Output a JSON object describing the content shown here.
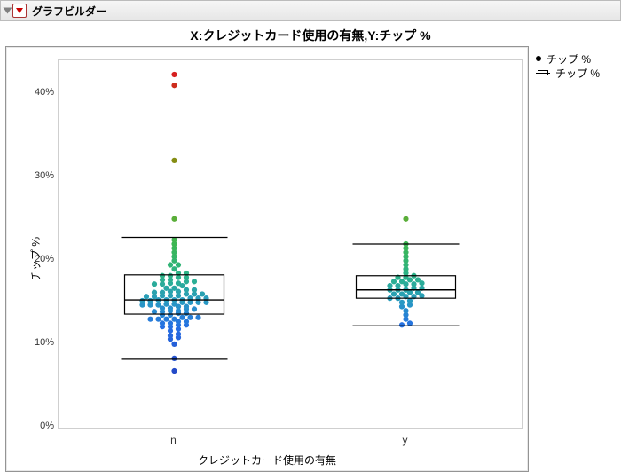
{
  "window": {
    "title": "グラフビルダー"
  },
  "chart_title": "X:クレジットカード使用の有無,Y:チップ %",
  "legend": {
    "points_label": "チップ %",
    "box_label": "チップ %"
  },
  "axes": {
    "ylabel": "チップ %",
    "xlabel": "クレジットカード使用の有無",
    "yticks": [
      "0%",
      "10%",
      "20%",
      "30%",
      "40%"
    ],
    "ytick_vals": [
      0,
      10,
      20,
      30,
      40
    ],
    "categories": [
      "n",
      "y"
    ]
  },
  "chart_data": {
    "type": "box",
    "title": "X:クレジットカード使用の有無,Y:チップ %",
    "xlabel": "クレジットカード使用の有無",
    "ylabel": "チップ %",
    "ylim": [
      0,
      44
    ],
    "categories": [
      "n",
      "y"
    ],
    "series": [
      {
        "name": "n",
        "box": {
          "whisker_low": 8.2,
          "q1": 13.6,
          "median": 15.3,
          "q3": 18.3,
          "whisker_high": 22.8
        },
        "points": [
          6.8,
          8.3,
          10.0,
          10.6,
          10.8,
          11.0,
          11.2,
          11.6,
          11.8,
          12.1,
          12.1,
          12.3,
          12.3,
          12.5,
          12.5,
          12.7,
          12.7,
          13.0,
          13.0,
          13.0,
          13.0,
          13.2,
          13.2,
          13.2,
          13.5,
          13.5,
          13.7,
          13.7,
          13.9,
          13.9,
          14.0,
          14.0,
          14.2,
          14.2,
          14.3,
          14.3,
          14.5,
          14.5,
          14.7,
          14.7,
          14.7,
          14.8,
          14.8,
          15.0,
          15.0,
          15.0,
          15.0,
          15.2,
          15.2,
          15.3,
          15.3,
          15.3,
          15.3,
          15.5,
          15.5,
          15.5,
          15.7,
          15.7,
          15.8,
          15.8,
          15.8,
          16.0,
          16.0,
          16.0,
          16.2,
          16.2,
          16.3,
          16.3,
          16.5,
          16.5,
          16.7,
          16.7,
          17.0,
          17.2,
          17.2,
          17.3,
          17.3,
          17.5,
          17.5,
          17.7,
          17.7,
          18.0,
          18.0,
          18.2,
          18.2,
          18.5,
          18.5,
          19.0,
          19.5,
          19.5,
          20.0,
          20.5,
          21.0,
          21.5,
          22.0,
          22.5,
          25.0,
          32.0,
          41.0,
          42.3
        ]
      },
      {
        "name": "y",
        "box": {
          "whisker_low": 12.2,
          "q1": 15.5,
          "median": 16.5,
          "q3": 18.2,
          "whisker_high": 22.0
        },
        "points": [
          12.3,
          12.5,
          13.0,
          13.5,
          14.0,
          14.5,
          14.7,
          15.0,
          15.2,
          15.5,
          15.5,
          15.7,
          15.7,
          15.8,
          16.0,
          16.0,
          16.2,
          16.2,
          16.5,
          16.5,
          16.5,
          16.7,
          16.7,
          17.0,
          17.0,
          17.2,
          17.2,
          17.3,
          17.5,
          17.5,
          17.7,
          17.7,
          18.0,
          18.0,
          18.2,
          18.5,
          19.0,
          19.5,
          20.0,
          20.5,
          21.0,
          21.5,
          22.0,
          25.0
        ]
      }
    ],
    "point_coloring": "value-gradient (blue→green→red by チップ %)"
  }
}
